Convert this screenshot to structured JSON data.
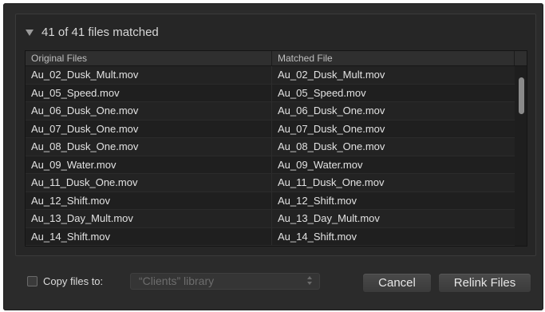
{
  "group": {
    "title": "41 of 41 files matched"
  },
  "table": {
    "columns": [
      "Original Files",
      "Matched File"
    ],
    "rows": [
      {
        "original": "Au_02_Dusk_Mult.mov",
        "matched": "Au_02_Dusk_Mult.mov"
      },
      {
        "original": "Au_05_Speed.mov",
        "matched": "Au_05_Speed.mov"
      },
      {
        "original": "Au_06_Dusk_One.mov",
        "matched": "Au_06_Dusk_One.mov"
      },
      {
        "original": "Au_07_Dusk_One.mov",
        "matched": "Au_07_Dusk_One.mov"
      },
      {
        "original": "Au_08_Dusk_One.mov",
        "matched": "Au_08_Dusk_One.mov"
      },
      {
        "original": "Au_09_Water.mov",
        "matched": "Au_09_Water.mov"
      },
      {
        "original": "Au_11_Dusk_One.mov",
        "matched": "Au_11_Dusk_One.mov"
      },
      {
        "original": "Au_12_Shift.mov",
        "matched": "Au_12_Shift.mov"
      },
      {
        "original": "Au_13_Day_Mult.mov",
        "matched": "Au_13_Day_Mult.mov"
      },
      {
        "original": "Au_14_Shift.mov",
        "matched": "Au_14_Shift.mov"
      }
    ]
  },
  "footer": {
    "copy_label": "Copy files to:",
    "copy_checked": false,
    "library_select": "“Clients” library",
    "cancel_label": "Cancel",
    "relink_label": "Relink Files"
  },
  "colors": {
    "dialog_bg": "#2b2b2b",
    "table_bg": "#1e1e1e",
    "text": "#e2e2e2",
    "disabled_text": "#6d6d6d"
  }
}
